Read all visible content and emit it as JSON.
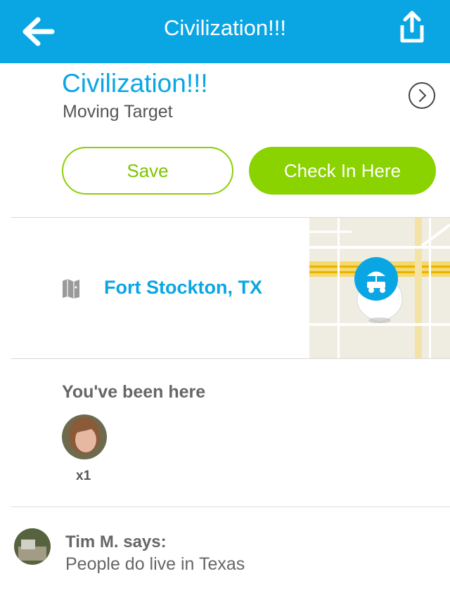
{
  "header": {
    "title": "Civilization!!!",
    "back_icon": "arrow-left-icon",
    "share_icon": "share-icon"
  },
  "venue": {
    "name": "Civilization!!!",
    "category": "Moving Target"
  },
  "actions": {
    "save_label": "Save",
    "checkin_label": "Check In Here"
  },
  "location": {
    "city": "Fort Stockton, TX",
    "icon": "map-icon",
    "pin_icon": "food-truck-icon"
  },
  "visits": {
    "heading": "You've been here",
    "count": "x1"
  },
  "tip": {
    "author": "Tim M. says:",
    "text": "People do live in Texas"
  },
  "colors": {
    "brand_blue": "#0aa6e4",
    "accent_green": "#8ad200"
  }
}
